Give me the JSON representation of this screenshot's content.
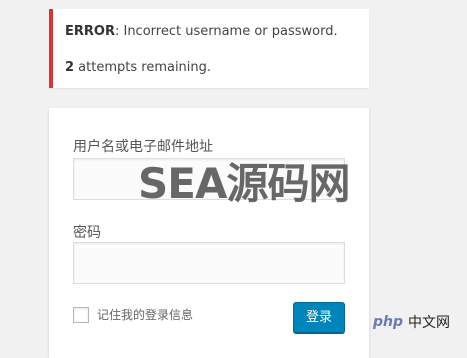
{
  "notice": {
    "error_prefix": "ERROR",
    "error_message": ": Incorrect username or password.",
    "attempts_count": "2",
    "attempts_text": " attempts remaining."
  },
  "form": {
    "username_label": "用户名或电子邮件地址",
    "username_value": "",
    "password_label": "密码",
    "password_value": "",
    "remember_label": "记住我的登录信息",
    "remember_checked": false,
    "submit_label": "登录"
  },
  "watermark": {
    "text": "SEA源码网"
  },
  "badge": {
    "logo_text": "php",
    "site_text": "中文网"
  },
  "colors": {
    "error_border": "#dc3232",
    "button_bg": "#0085ba",
    "page_bg": "#f1f1f1"
  }
}
